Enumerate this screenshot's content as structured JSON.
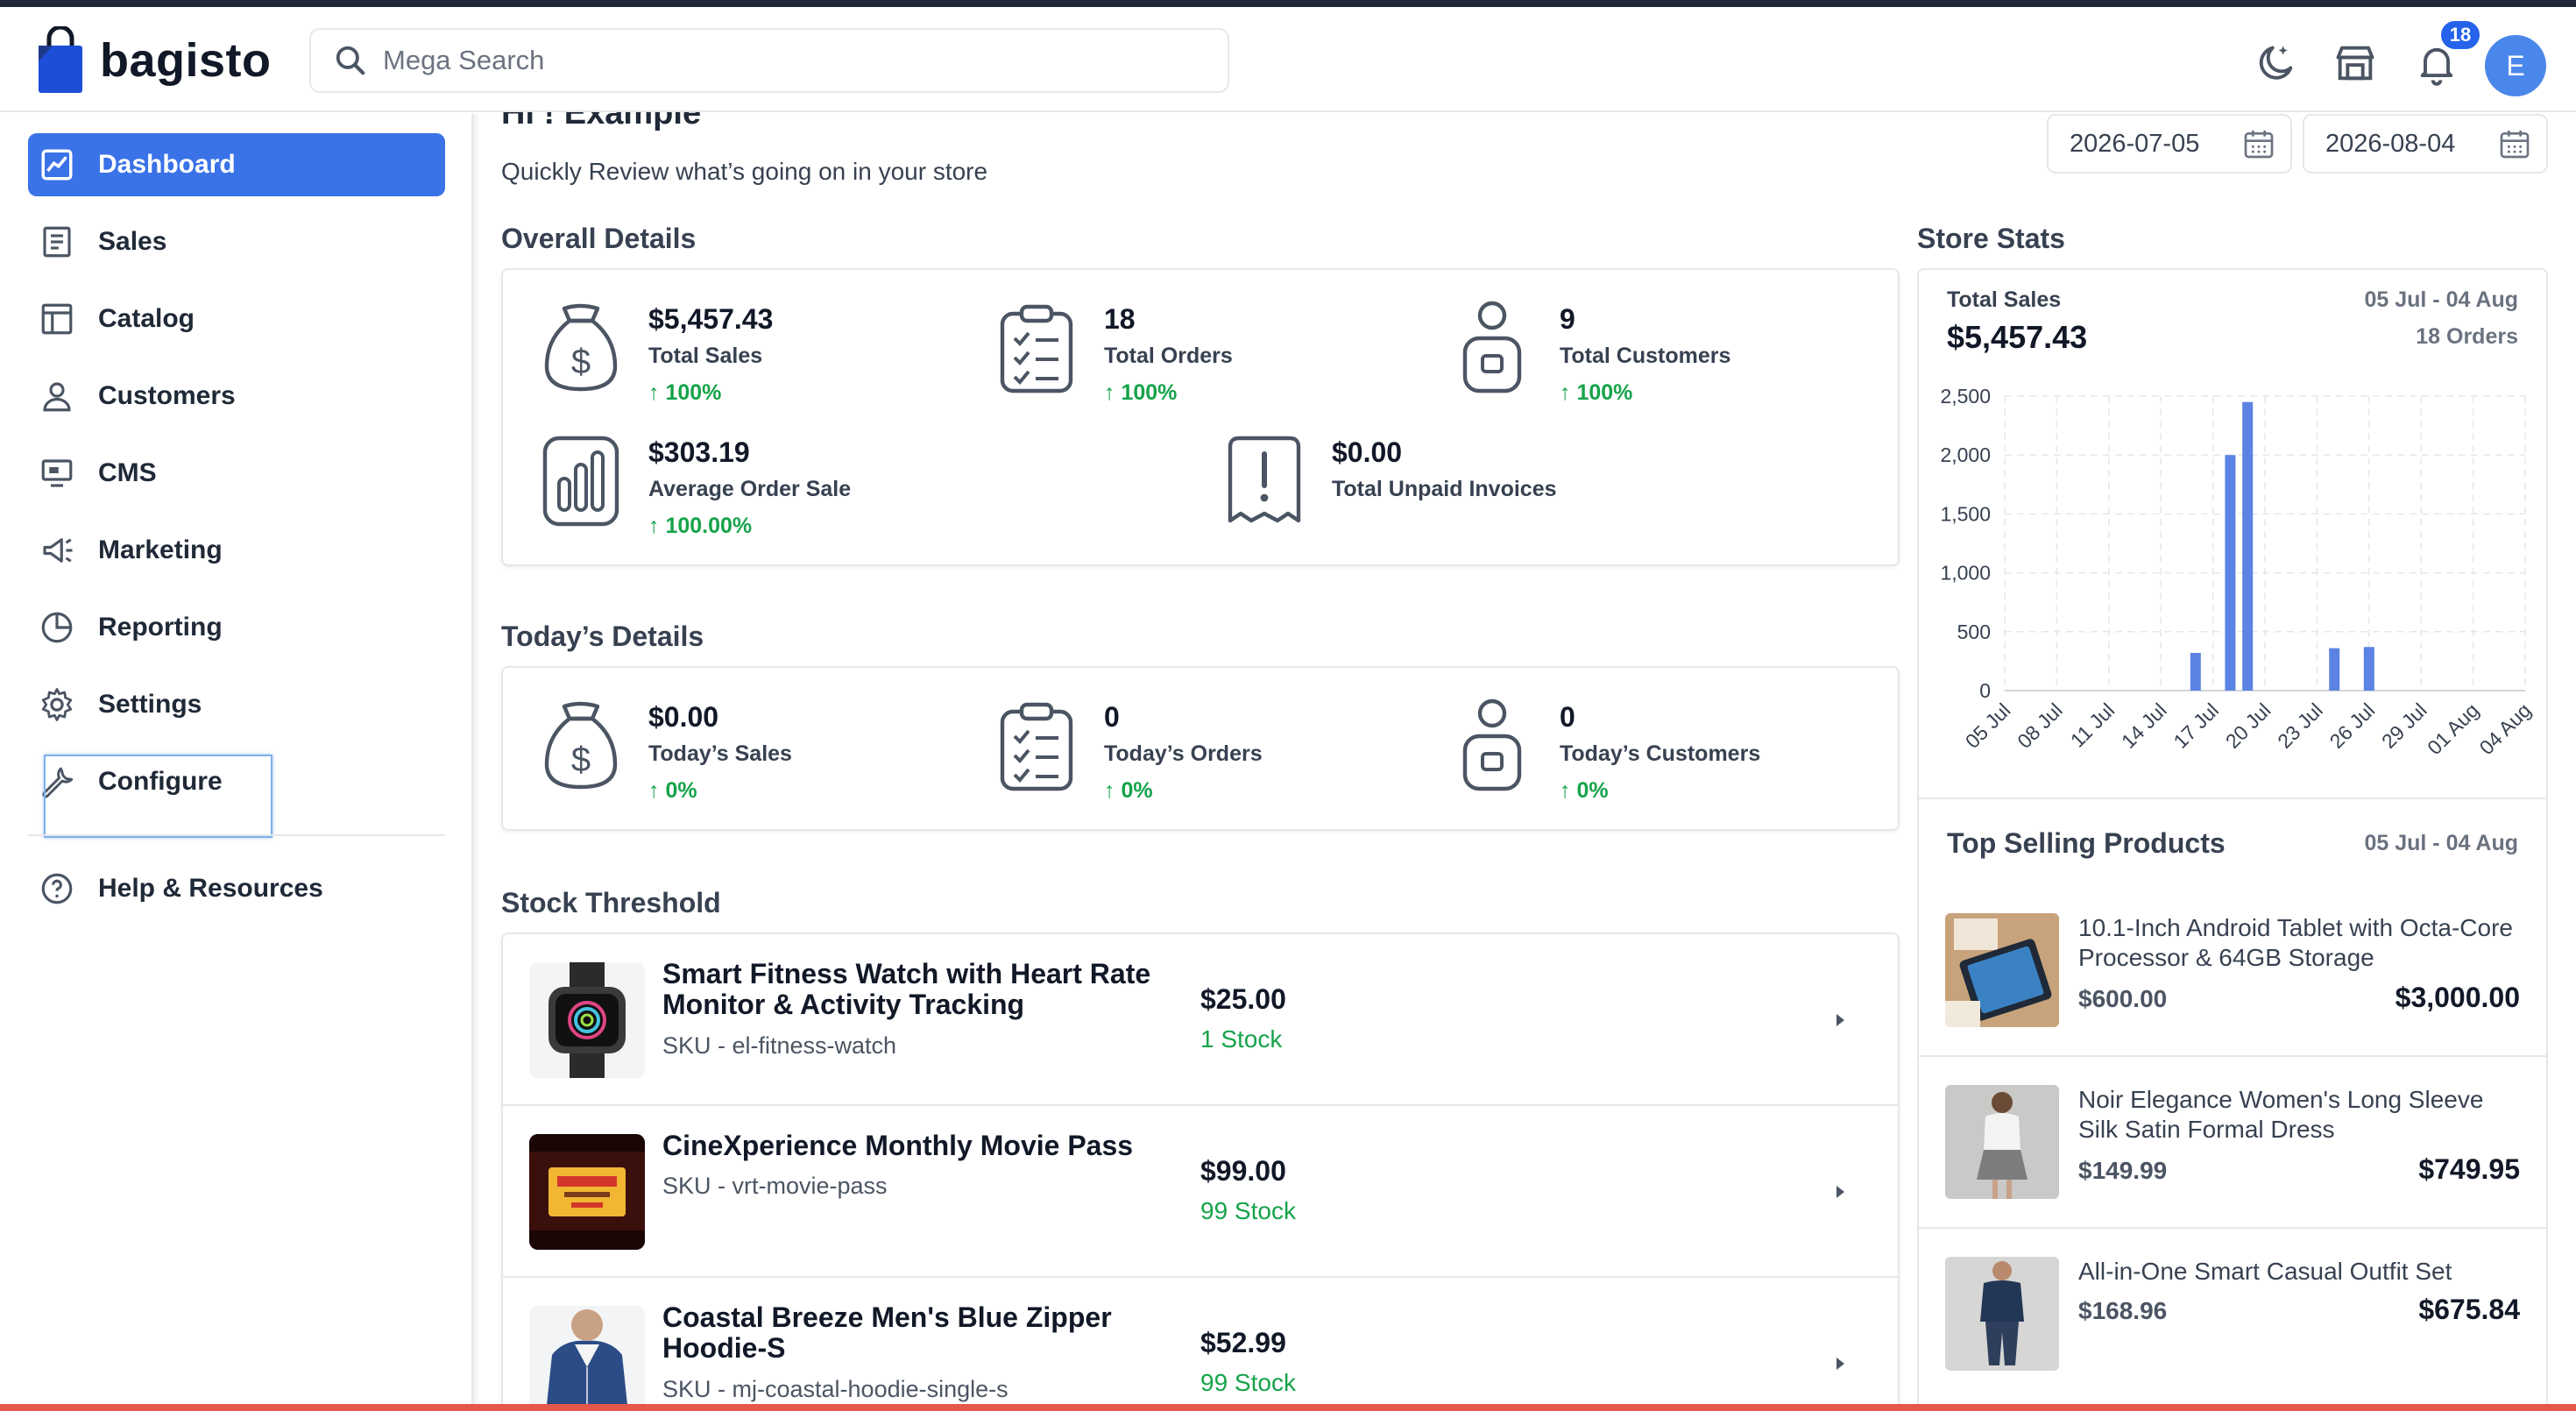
{
  "header": {
    "logo_text": "bagisto",
    "search_placeholder": "Mega Search",
    "notification_count": "18",
    "avatar_letter": "E"
  },
  "sidebar": {
    "items": [
      {
        "label": "Dashboard",
        "icon": "dashboard-icon",
        "active": true
      },
      {
        "label": "Sales",
        "icon": "sales-icon"
      },
      {
        "label": "Catalog",
        "icon": "catalog-icon"
      },
      {
        "label": "Customers",
        "icon": "customers-icon"
      },
      {
        "label": "CMS",
        "icon": "cms-icon"
      },
      {
        "label": "Marketing",
        "icon": "marketing-icon"
      },
      {
        "label": "Reporting",
        "icon": "reporting-icon"
      },
      {
        "label": "Settings",
        "icon": "settings-icon"
      },
      {
        "label": "Configure",
        "icon": "configure-icon"
      },
      {
        "label": "Help & Resources",
        "icon": "help-icon"
      }
    ]
  },
  "main": {
    "greeting": "Hi ! Example",
    "subtitle": "Quickly Review what’s going on in your store",
    "date_start": "2026-07-05",
    "date_end": "2026-08-04",
    "overall_title": "Overall Details",
    "overall": {
      "total_sales": {
        "value": "$5,457.43",
        "label": "Total Sales",
        "change": "100%"
      },
      "total_orders": {
        "value": "18",
        "label": "Total Orders",
        "change": "100%"
      },
      "total_customers": {
        "value": "9",
        "label": "Total Customers",
        "change": "100%"
      },
      "average_order": {
        "value": "$303.19",
        "label": "Average Order Sale",
        "change": "100.00%"
      },
      "unpaid_invoices": {
        "value": "$0.00",
        "label": "Total Unpaid Invoices"
      }
    },
    "today_title": "Today’s Details",
    "today": {
      "sales": {
        "value": "$0.00",
        "label": "Today’s Sales",
        "change": "0%"
      },
      "orders": {
        "value": "0",
        "label": "Today’s Orders",
        "change": "0%"
      },
      "customers": {
        "value": "0",
        "label": "Today’s Customers",
        "change": "0%"
      }
    },
    "stock_title": "Stock Threshold",
    "stock_items": [
      {
        "name": "Smart Fitness Watch with Heart Rate Monitor & Activity Tracking",
        "sku": "SKU - el-fitness-watch",
        "price": "$25.00",
        "stock": "1 Stock"
      },
      {
        "name": "CineXperience Monthly Movie Pass",
        "sku": "SKU - vrt-movie-pass",
        "price": "$99.00",
        "stock": "99 Stock"
      },
      {
        "name": "Coastal Breeze Men's Blue Zipper Hoodie-S",
        "sku": "SKU - mj-coastal-hoodie-single-s",
        "price": "$52.99",
        "stock": "99 Stock"
      }
    ]
  },
  "store_stats": {
    "title": "Store Stats",
    "total_sales_label": "Total Sales",
    "total_sales_value": "$5,457.43",
    "range": "05 Jul - 04 Aug",
    "orders": "18 Orders",
    "top_title": "Top Selling Products",
    "top_range": "05 Jul - 04 Aug",
    "top_products": [
      {
        "name": "10.1-Inch Android Tablet with Octa-Core Processor & 64GB Storage",
        "price": "$600.00",
        "total": "$3,000.00"
      },
      {
        "name": "Noir Elegance Women's Long Sleeve Silk Satin Formal Dress",
        "price": "$149.99",
        "total": "$749.95"
      },
      {
        "name": "All-in-One Smart Casual Outfit Set",
        "price": "$168.96",
        "total": "$675.84"
      }
    ]
  },
  "chart_data": {
    "type": "bar",
    "x_ticks": [
      "05 Jul",
      "08 Jul",
      "11 Jul",
      "14 Jul",
      "17 Jul",
      "20 Jul",
      "23 Jul",
      "26 Jul",
      "29 Jul",
      "01 Aug",
      "04 Aug"
    ],
    "y_ticks": [
      "2,500",
      "2,000",
      "1,500",
      "1,000",
      "500",
      "0"
    ],
    "ylim": [
      0,
      2500
    ],
    "day_count": 31,
    "values": [
      0,
      0,
      0,
      0,
      0,
      0,
      0,
      0,
      0,
      0,
      0,
      320,
      0,
      2000,
      2450,
      0,
      0,
      0,
      0,
      360,
      0,
      370,
      0,
      0,
      0,
      0,
      0,
      0,
      0,
      0,
      0
    ],
    "bar_color": "#5b83e3",
    "grid": true
  },
  "colors": {
    "accent": "#3a72e8",
    "positive": "#16a34a",
    "badge": "#2563eb"
  }
}
